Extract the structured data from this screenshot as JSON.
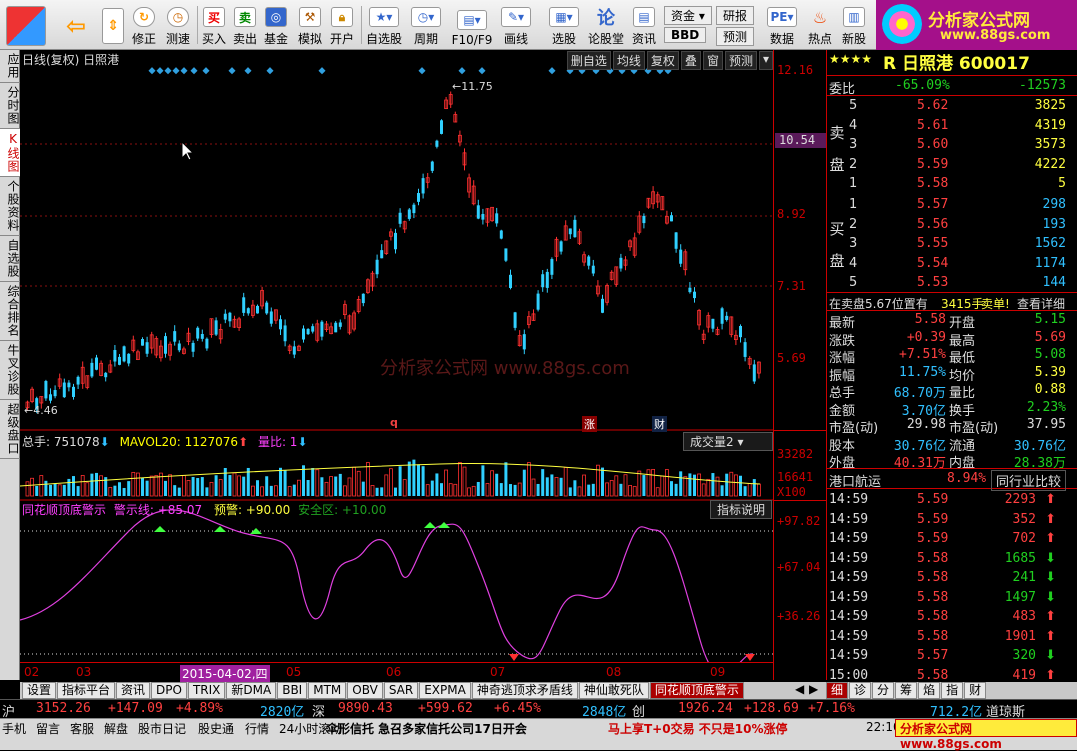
{
  "toolbar": {
    "items": [
      "修正",
      "测速",
      "买入",
      "卖出",
      "基金",
      "模拟",
      "开户",
      "自选股",
      "周期",
      "F10/F9",
      "画线",
      "选股",
      "论股堂",
      "资讯",
      "资金",
      "BBD",
      "研报",
      "预测",
      "数据",
      "热点",
      "新股"
    ]
  },
  "logo": {
    "title": "分析家公式网",
    "url": "www.88gs.com"
  },
  "left_tabs": [
    {
      "label": "应用"
    },
    {
      "label": "分时图"
    },
    {
      "label": "K线图",
      "active": true
    },
    {
      "label": "个股资料"
    },
    {
      "label": "自选股"
    },
    {
      "label": "综合排名"
    },
    {
      "label": "牛叉诊股"
    },
    {
      "label": "超级盘口"
    }
  ],
  "chart": {
    "header": "日线(复权)  日照港",
    "buttons": [
      "删自选",
      "均线",
      "复权",
      "叠",
      "窗",
      "预测"
    ],
    "y_labels": [
      "12.16",
      "10.54",
      "8.92",
      "7.31",
      "5.69"
    ],
    "current_price": "10.54",
    "high_label": "11.75",
    "low_label": "4.46",
    "watermark": "分析家公式网 www.88gs.com",
    "event_marks": [
      "q",
      "涨",
      "财"
    ],
    "vol_legend": {
      "a": "总手: 751078",
      "b": "MAVOL20: 1127076",
      "c": "量比: 1"
    },
    "vol_dropdown": "成交量2",
    "vol_labels": [
      "33282",
      "16641",
      "X100"
    ],
    "ind_legend": {
      "name": "同花顺顶底警示",
      "warn": "警示线: +85.07",
      "pre": "预警: +90.00",
      "safe": "安全区: +10.00"
    },
    "ind_button": "指标说明",
    "ind_labels": [
      "+97.82",
      "+67.04",
      "+36.26"
    ],
    "dates": [
      "02",
      "03",
      "2015-04-02,四",
      "05",
      "06",
      "07",
      "08",
      "09"
    ]
  },
  "chart_data": {
    "type": "candlestick",
    "ylim": [
      4.46,
      12.16
    ],
    "high": 11.75,
    "low": 4.46,
    "last": 5.58,
    "indicator_levels": {
      "warn": 85.07,
      "pre": 90.0,
      "safe": 10.0
    }
  },
  "quote": {
    "stars": "★★★★",
    "title": "R 日照港 600017",
    "weibi": {
      "label": "委比",
      "pct": "-65.09%",
      "diff": "-12573"
    },
    "sell_label": "卖盘",
    "buy_label": "买盘",
    "asks": [
      {
        "n": "5",
        "p": "5.62",
        "v": "3825"
      },
      {
        "n": "4",
        "p": "5.61",
        "v": "4319"
      },
      {
        "n": "3",
        "p": "5.60",
        "v": "3573"
      },
      {
        "n": "2",
        "p": "5.59",
        "v": "4222"
      },
      {
        "n": "1",
        "p": "5.58",
        "v": "5"
      }
    ],
    "bids": [
      {
        "n": "1",
        "p": "5.57",
        "v": "298"
      },
      {
        "n": "2",
        "p": "5.56",
        "v": "193"
      },
      {
        "n": "3",
        "p": "5.55",
        "v": "1562"
      },
      {
        "n": "4",
        "p": "5.54",
        "v": "1174"
      },
      {
        "n": "5",
        "p": "5.53",
        "v": "144"
      }
    ],
    "notice": {
      "a": "在卖盘5.67位置有",
      "b": "3415手",
      "c": "卖单!",
      "d": "查看详细"
    },
    "stats": [
      [
        "最新",
        "5.58",
        "开盘",
        "5.15"
      ],
      [
        "涨跌",
        "+0.39",
        "最高",
        "5.69"
      ],
      [
        "涨幅",
        "+7.51%",
        "最低",
        "5.08"
      ],
      [
        "振幅",
        "11.75%",
        "均价",
        "5.39"
      ],
      [
        "总手",
        "68.70万",
        "量比",
        "0.88"
      ],
      [
        "金额",
        "3.70亿",
        "换手",
        "2.23%"
      ],
      [
        "市盈(动)",
        "29.98",
        "市盈(动)",
        "37.95"
      ],
      [
        "股本",
        "30.76亿",
        "流通",
        "30.76亿"
      ],
      [
        "外盘",
        "40.31万",
        "内盘",
        "28.38万"
      ]
    ],
    "sector": {
      "name": "港口航运",
      "pct": "8.94%",
      "btn": "同行业比较"
    },
    "ticks": [
      {
        "t": "14:59",
        "p": "5.59",
        "v": "2293",
        "d": "up"
      },
      {
        "t": "14:59",
        "p": "5.59",
        "v": "352",
        "d": "up"
      },
      {
        "t": "14:59",
        "p": "5.59",
        "v": "702",
        "d": "up"
      },
      {
        "t": "14:59",
        "p": "5.58",
        "v": "1685",
        "d": "down"
      },
      {
        "t": "14:59",
        "p": "5.58",
        "v": "241",
        "d": "down"
      },
      {
        "t": "14:59",
        "p": "5.58",
        "v": "1497",
        "d": "down"
      },
      {
        "t": "14:59",
        "p": "5.58",
        "v": "483",
        "d": "up"
      },
      {
        "t": "14:59",
        "p": "5.58",
        "v": "1901",
        "d": "up"
      },
      {
        "t": "14:59",
        "p": "5.57",
        "v": "320",
        "d": "down"
      },
      {
        "t": "15:00",
        "p": "5.58",
        "v": "419",
        "d": "up"
      }
    ]
  },
  "indicator_tabs": [
    "设置",
    "指标平台",
    "资讯",
    "DPO",
    "TRIX",
    "新DMA",
    "BBI",
    "MTM",
    "OBV",
    "SAR",
    "EXPMA",
    "神奇逃顶求矛盾线",
    "神仙敢死队",
    "同花顺顶底警示"
  ],
  "right_tabs": [
    "细",
    "诊",
    "分",
    "筹",
    "焰",
    "指",
    "财"
  ],
  "index_bar": {
    "sh_label": "沪",
    "sh": "3152.26",
    "sh_chg": "+147.09",
    "sh_pct": "+4.89%",
    "sz_vol": "2820亿",
    "sz_label": "深",
    "sz": "9890.43",
    "sz_chg": "+599.62",
    "sz_pct": "+6.45%",
    "cy_vol": "2848亿",
    "cy_label": "创",
    "cy": "1926.24",
    "cy_chg": "+128.69",
    "cy_pct": "+7.16%",
    "dj_vol": "712.2亿",
    "dj_label": "道琼斯"
  },
  "status_bar": {
    "items": [
      "手机",
      "留言",
      "客服",
      "解盘",
      "股市日记",
      "股史通",
      "行情",
      "24小时滚动"
    ],
    "news": "伞形信托 急召多家信托公司17日开会",
    "promo": "马上享T+0交易 不只是10%涨停",
    "clock": "22:10",
    "brand": "分析家公式网 www.88gs.com"
  }
}
